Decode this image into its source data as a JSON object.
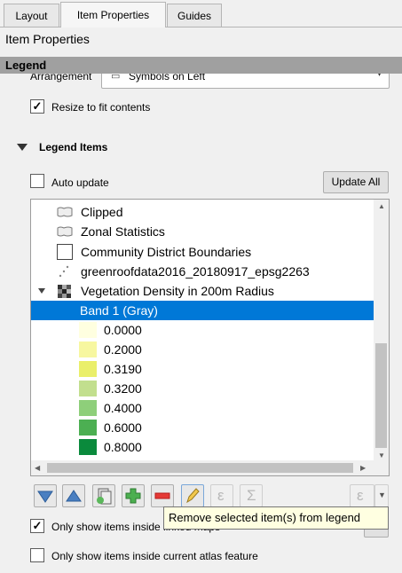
{
  "tabs": [
    {
      "label": "Layout"
    },
    {
      "label": "Item Properties"
    },
    {
      "label": "Guides"
    }
  ],
  "panel_title": "Item Properties",
  "legend_header": "Legend",
  "arrangement": {
    "label": "Arrangement",
    "value": "Symbols on Left"
  },
  "resize_to_fit": {
    "label": "Resize to fit contents",
    "checked": true
  },
  "legend_items": {
    "header": "Legend Items",
    "auto_update": {
      "label": "Auto update",
      "checked": false
    },
    "update_all_label": "Update All",
    "tree": [
      {
        "label": "Clipped",
        "icon": "polygon-layer-icon"
      },
      {
        "label": "Zonal Statistics",
        "icon": "polygon-layer-icon"
      },
      {
        "label": "Community District Boundaries",
        "icon": "empty-square-symbol-icon"
      },
      {
        "label": "greenroofdata2016_20180917_epsg2263",
        "icon": "point-layer-icon"
      },
      {
        "label": "Vegetation Density in 200m Radius",
        "icon": "raster-layer-icon",
        "expanded": true
      },
      {
        "label": "Band 1 (Gray)",
        "selected": true
      }
    ],
    "ramp": [
      {
        "label": "0.0000",
        "color": "#ffffe0"
      },
      {
        "label": "0.2000",
        "color": "#f7f7a0"
      },
      {
        "label": "0.3190",
        "color": "#eaef6a"
      },
      {
        "label": "0.3200",
        "color": "#c2df8e"
      },
      {
        "label": "0.4000",
        "color": "#8ecf7a"
      },
      {
        "label": "0.6000",
        "color": "#4caf52"
      },
      {
        "label": "0.8000",
        "color": "#0a8a3c"
      }
    ]
  },
  "toolbar": {
    "tooltip": "Remove selected item(s) from legend"
  },
  "only_linked_maps": {
    "label": "Only show items inside linked maps",
    "checked": true
  },
  "only_atlas_feature": {
    "label": "Only show items inside current atlas feature",
    "checked": false
  },
  "colors": {
    "selection": "#0078d7",
    "header_bg": "#a0a0a0"
  }
}
